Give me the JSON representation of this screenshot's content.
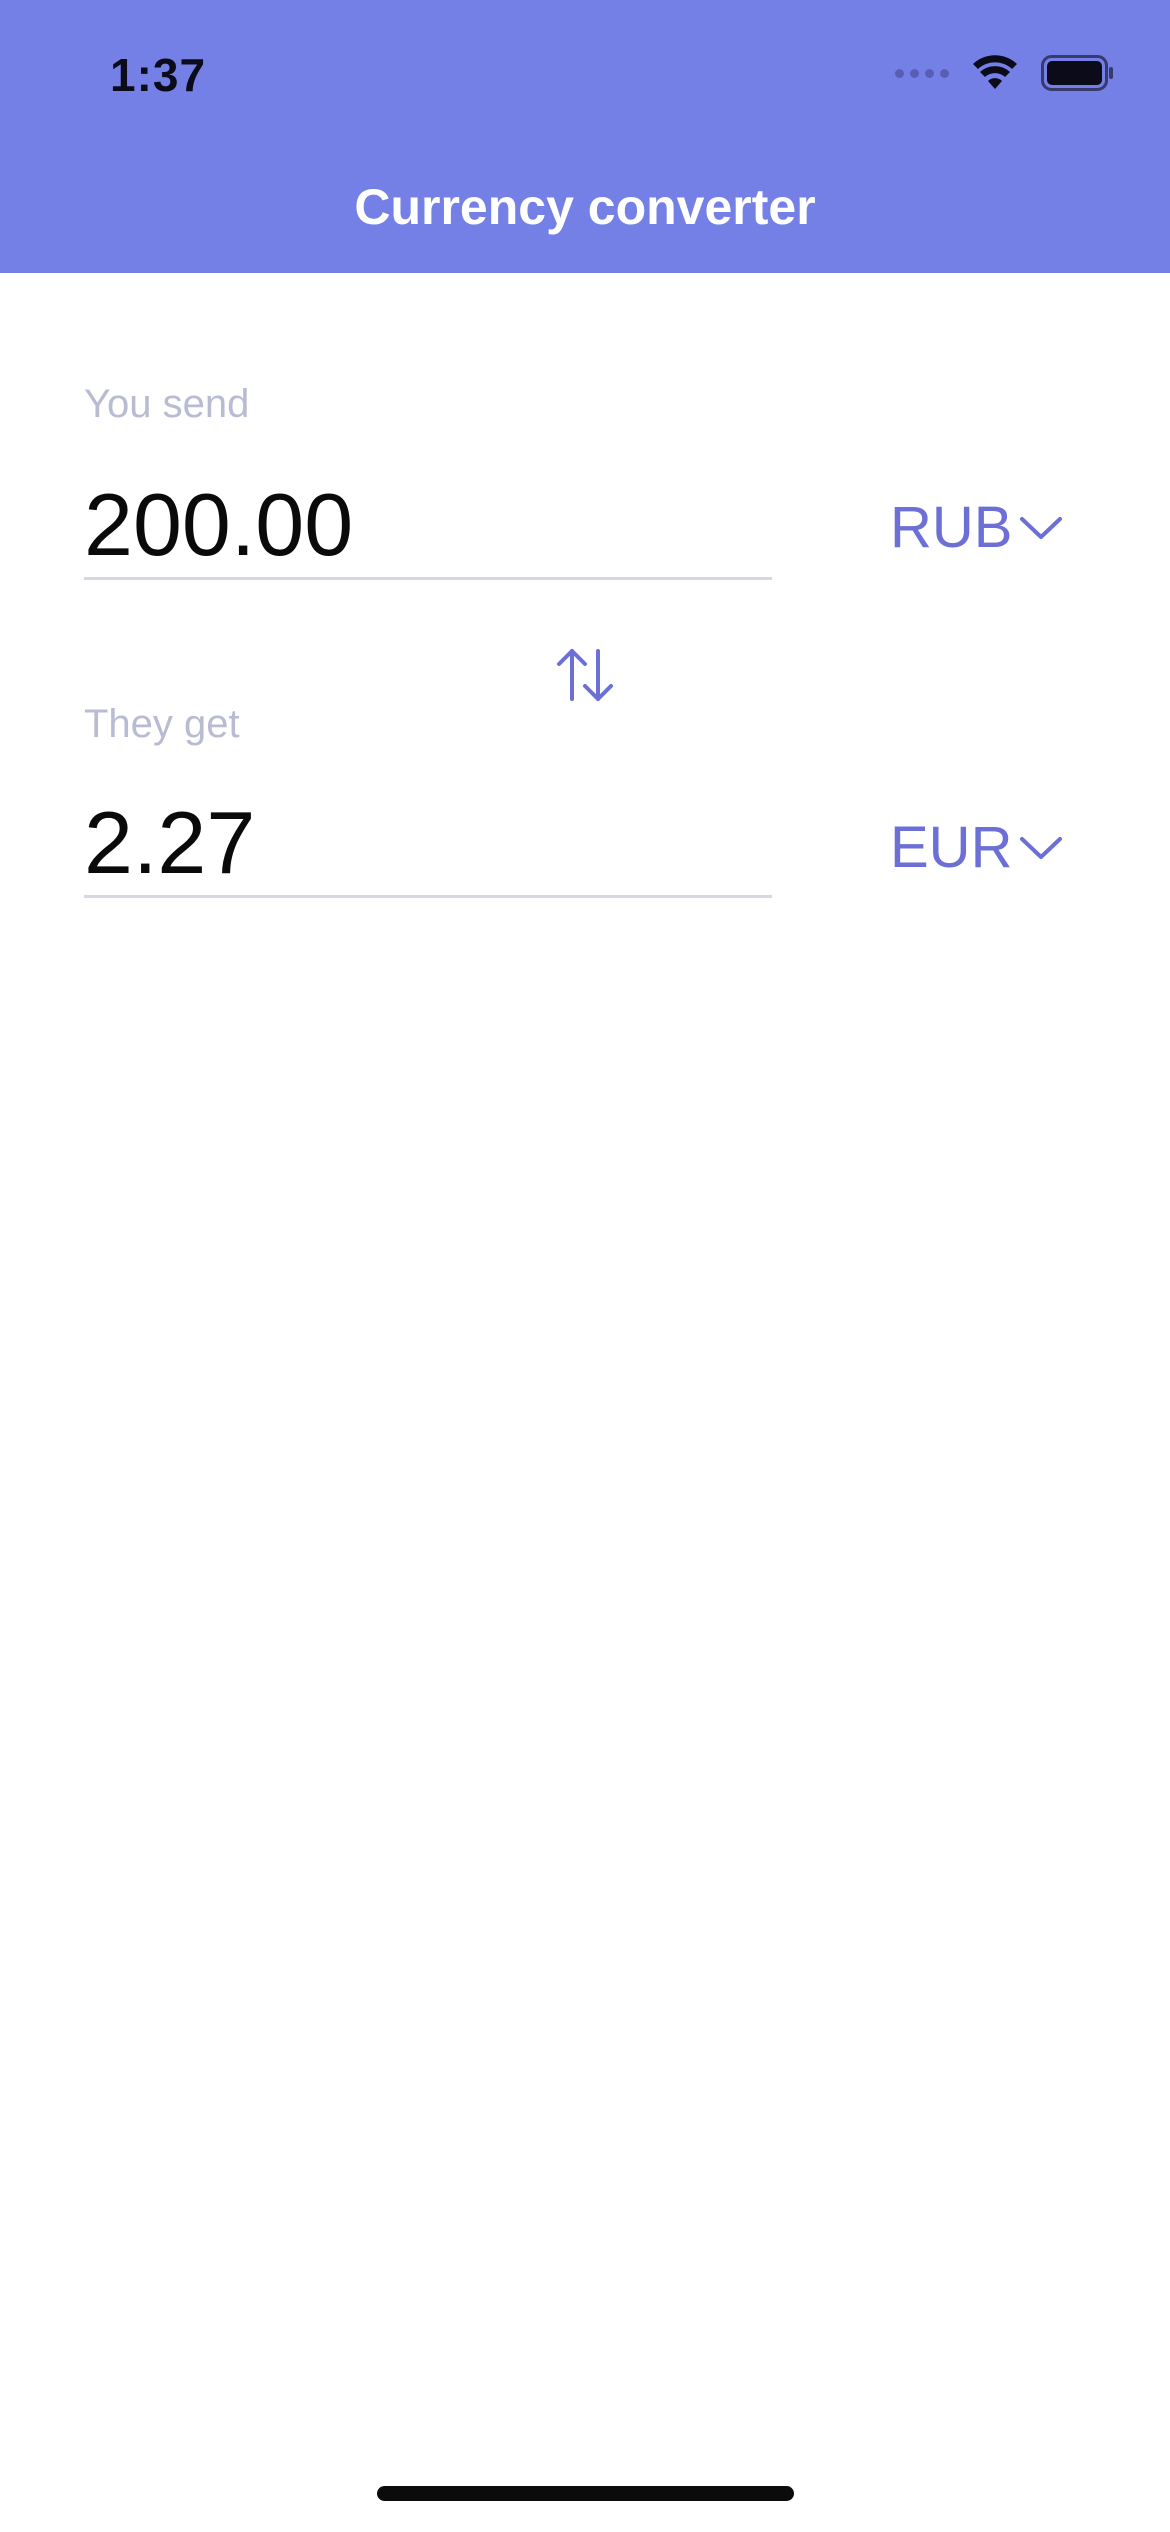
{
  "status_bar": {
    "time": "1:37"
  },
  "header": {
    "title": "Currency converter",
    "background_color": "#7580E6"
  },
  "send": {
    "label": "You send",
    "amount": "200.00",
    "currency": "RUB"
  },
  "receive": {
    "label": "They get",
    "amount": "2.27",
    "currency": "EUR"
  },
  "icons": {
    "swap": "swap-vertical-icon",
    "dropdown": "chevron-down-icon",
    "wifi": "wifi-icon",
    "battery": "battery-icon"
  },
  "colors": {
    "accent": "#6B6FD6",
    "label": "#B9BBD3",
    "underline": "#D6D7E3"
  }
}
